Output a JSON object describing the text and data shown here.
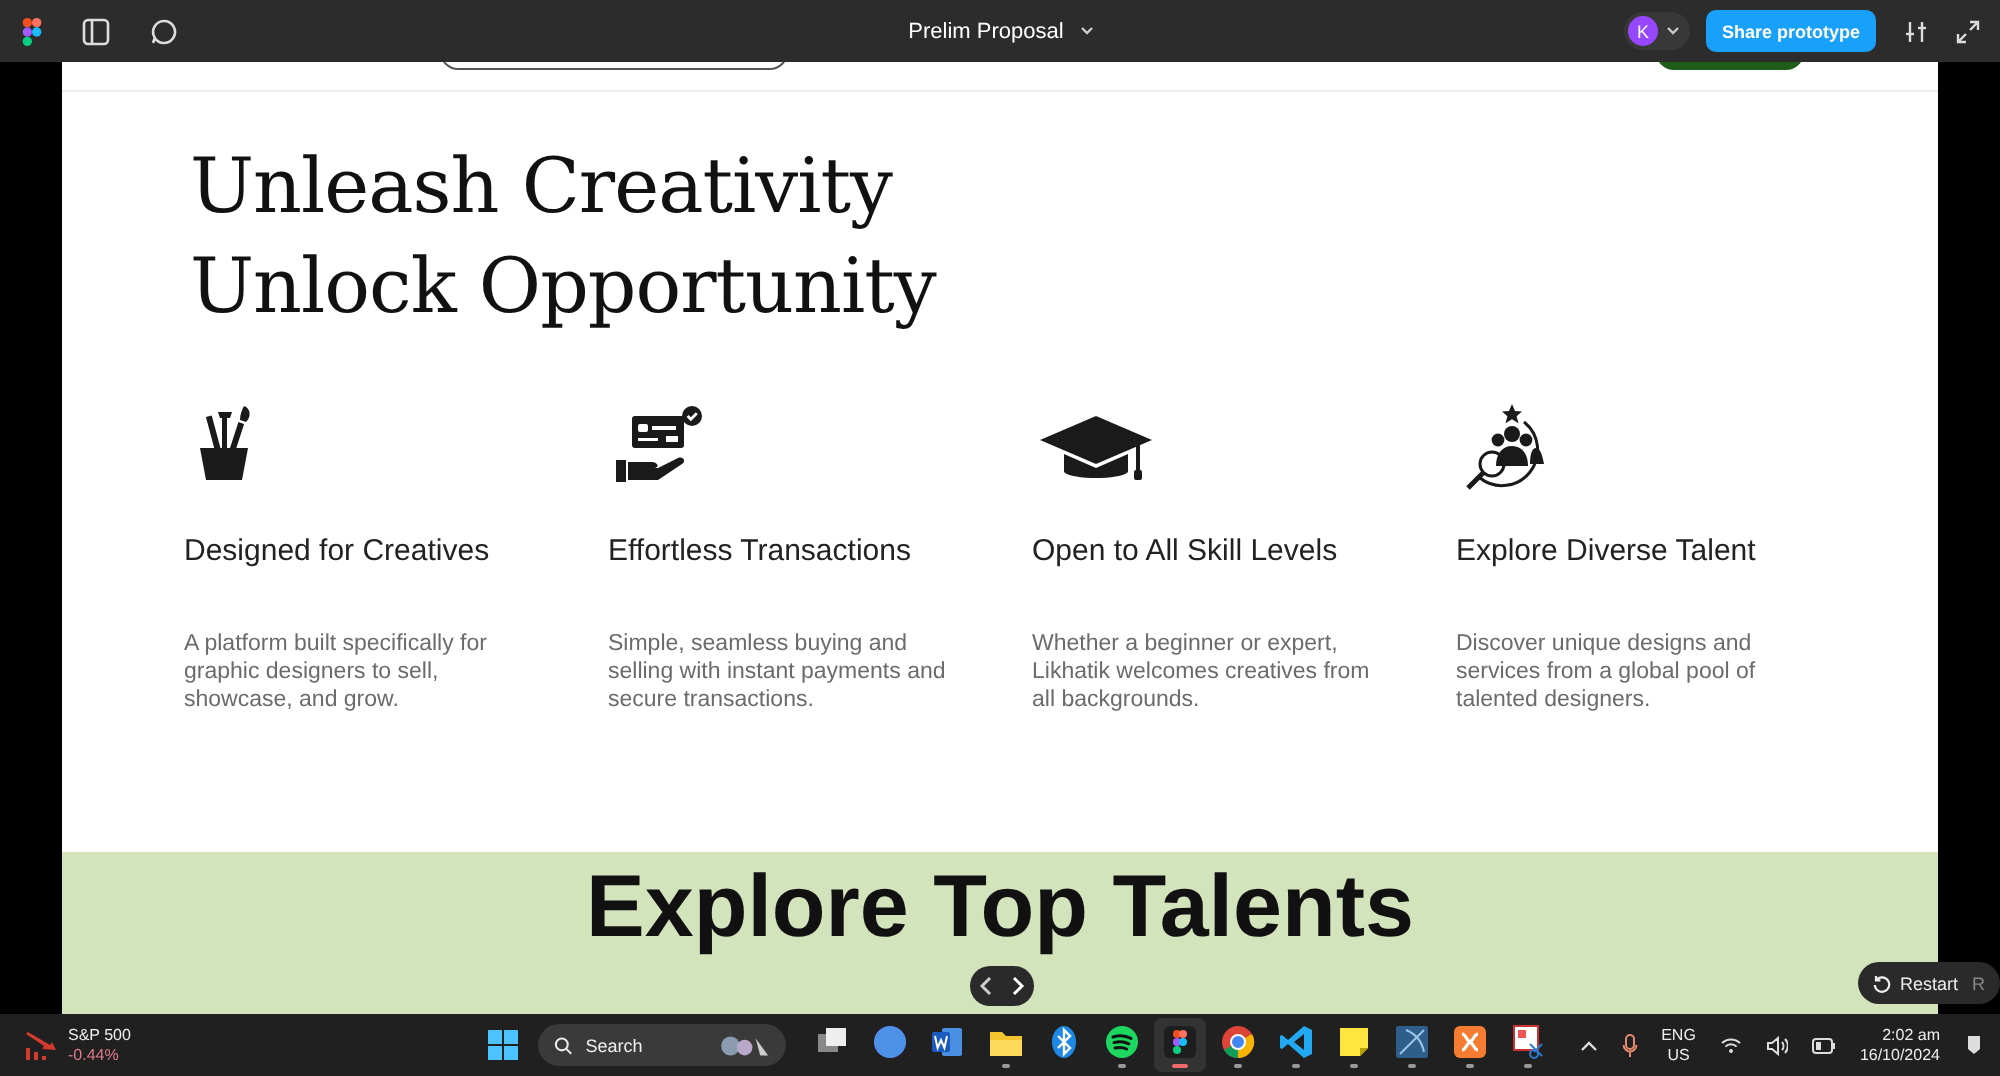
{
  "toolbar": {
    "title": "Prelim Proposal",
    "avatar": "K",
    "share_button": "Share prototype"
  },
  "hero": {
    "lines": [
      "Unleash Creativity",
      "Unlock Opportunity"
    ]
  },
  "features": [
    {
      "kind": "brushes",
      "title": "Designed for Creatives",
      "text": "A platform built specifically for graphic designers to sell, showcase, and grow."
    },
    {
      "kind": "payment",
      "title": "Effortless Transactions",
      "text": "Simple, seamless buying and selling with instant payments and secure transactions."
    },
    {
      "kind": "cap",
      "title": "Open to All Skill Levels",
      "text": "Whether a beginner or expert, Likhatik welcomes creatives from all backgrounds."
    },
    {
      "kind": "talent",
      "title": "Explore Diverse Talent",
      "text": "Discover unique designs and services from a global pool of talented designers."
    }
  ],
  "section": {
    "heading": "Explore Top Talents"
  },
  "restart": {
    "label": "Restart",
    "key": "R"
  },
  "taskbar": {
    "widget": {
      "name": "S&P 500",
      "change": "-0.44%"
    },
    "search": {
      "placeholder": "Search"
    },
    "apps": [
      {
        "kind": "taskview",
        "running": false,
        "selected": false
      },
      {
        "kind": "canva",
        "running": false,
        "selected": false
      },
      {
        "kind": "word",
        "running": false,
        "selected": false
      },
      {
        "kind": "folder",
        "running": true,
        "selected": false
      },
      {
        "kind": "bluetooth",
        "running": false,
        "selected": false
      },
      {
        "kind": "spotify",
        "running": true,
        "selected": false
      },
      {
        "kind": "figma",
        "running": true,
        "selected": true
      },
      {
        "kind": "chrome",
        "running": true,
        "selected": false
      },
      {
        "kind": "vscode",
        "running": true,
        "selected": false
      },
      {
        "kind": "notes",
        "running": true,
        "selected": false
      },
      {
        "kind": "blue",
        "running": true,
        "selected": false
      },
      {
        "kind": "xampp",
        "running": true,
        "selected": false
      },
      {
        "kind": "snip",
        "running": true,
        "selected": false
      }
    ],
    "language": [
      "ENG",
      "US"
    ],
    "time": "2:02 am",
    "date": "16/10/2024"
  }
}
